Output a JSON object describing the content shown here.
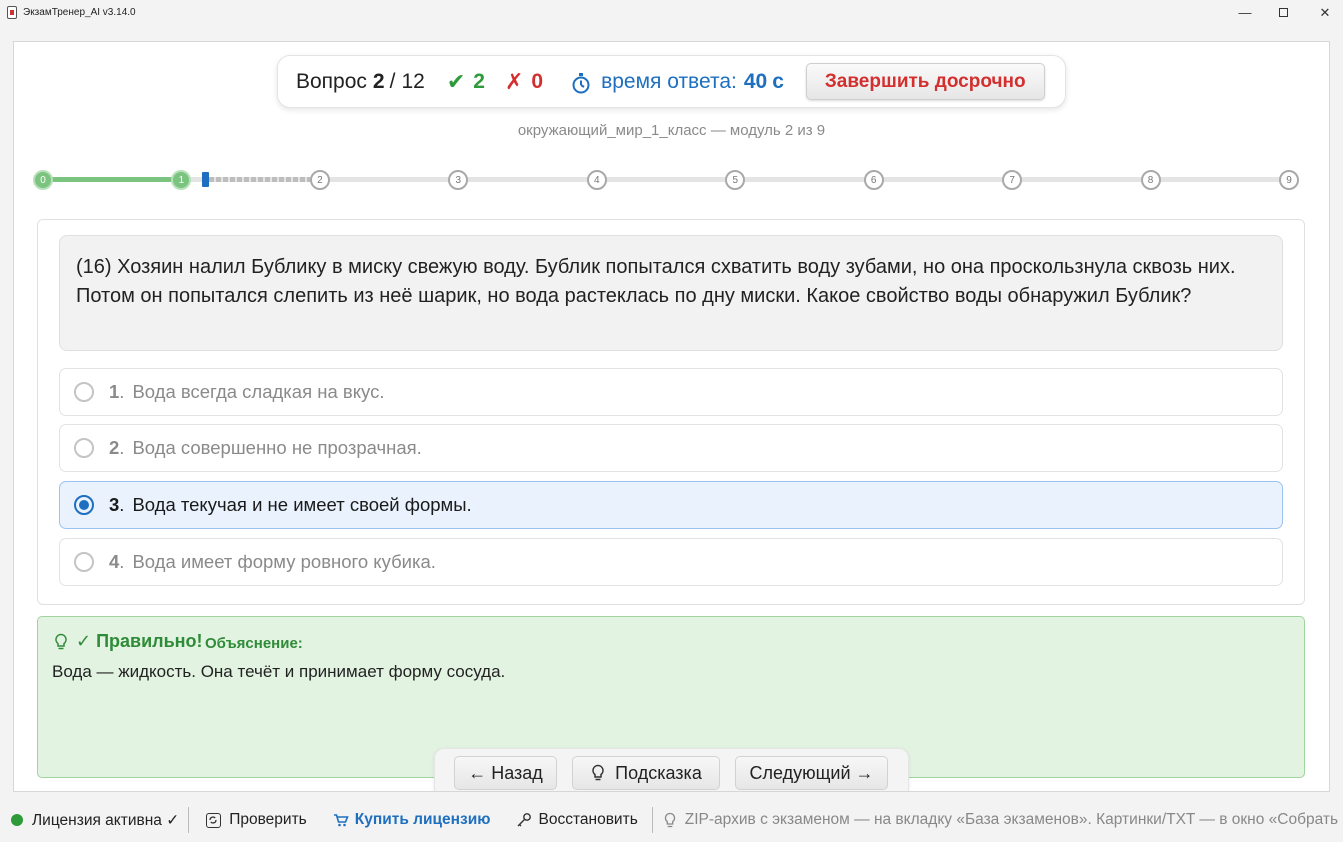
{
  "window": {
    "title": "ЭкзамТренер_AI v3.14.0",
    "minimize_glyph": "—",
    "close_glyph": "✕"
  },
  "header": {
    "question_prefix": "Вопрос",
    "question_current": "2",
    "question_separator": "/",
    "question_total": "12",
    "correct_icon": "✔",
    "correct_count": "2",
    "wrong_icon": "✗",
    "wrong_count": "0",
    "time_label": "время ответа:",
    "time_value": "40",
    "time_unit": "с",
    "finish_button": "Завершить досрочно"
  },
  "module_label": "окружающий_мир_1_класс — модуль 2 из 9",
  "progress": {
    "nodes": [
      "0",
      "1",
      "2",
      "3",
      "4",
      "5",
      "6",
      "7",
      "8",
      "9"
    ],
    "completed_modules": 1,
    "current_module_fraction": 0.17
  },
  "question": {
    "text": "(16) Хозяин налил Бублику в миску свежую воду. Бублик попытался схватить воду зубами, но она проскользнула сквозь них. Потом он попытался слепить из неё шарик, но вода растеклась по дну миски. Какое свойство воды обнаружил Бублик?"
  },
  "options": [
    {
      "num": "1",
      "dot": ".",
      "text": "Вода всегда сладкая на вкус.",
      "selected": false
    },
    {
      "num": "2",
      "dot": ".",
      "text": "Вода совершенно не прозрачная.",
      "selected": false
    },
    {
      "num": "3",
      "dot": ".",
      "text": "Вода текучая и не имеет своей формы.",
      "selected": true
    },
    {
      "num": "4",
      "dot": ".",
      "text": "Вода имеет форму ровного кубика.",
      "selected": false
    }
  ],
  "feedback": {
    "title": "✓ Правильно!",
    "explanation_label": "Объяснение:",
    "text": "Вода — жидкость. Она течёт и принимает форму сосуда."
  },
  "nav": {
    "back": "← Назад",
    "hint": "Подсказка",
    "next": "Следующий →"
  },
  "status": {
    "license": "Лицензия активна ✓",
    "check": "Проверить",
    "buy": "Купить лицензию",
    "restore": "Восстановить",
    "tip": "ZIP-архив с экзаменом — на вкладку «База экзаменов». Картинки/TXT — в окно «Собрать экзамен»"
  },
  "colors": {
    "accent_blue": "#1e6fbf",
    "correct_green": "#2e9a3a",
    "wrong_red": "#d32f2f",
    "progress_green": "#7bc47f",
    "feedback_bg": "#e3f3e1"
  },
  "icons": [
    "app-icon",
    "check-icon",
    "cross-icon",
    "stopwatch-icon",
    "lightbulb-icon",
    "refresh-icon",
    "cart-icon",
    "key-icon"
  ]
}
